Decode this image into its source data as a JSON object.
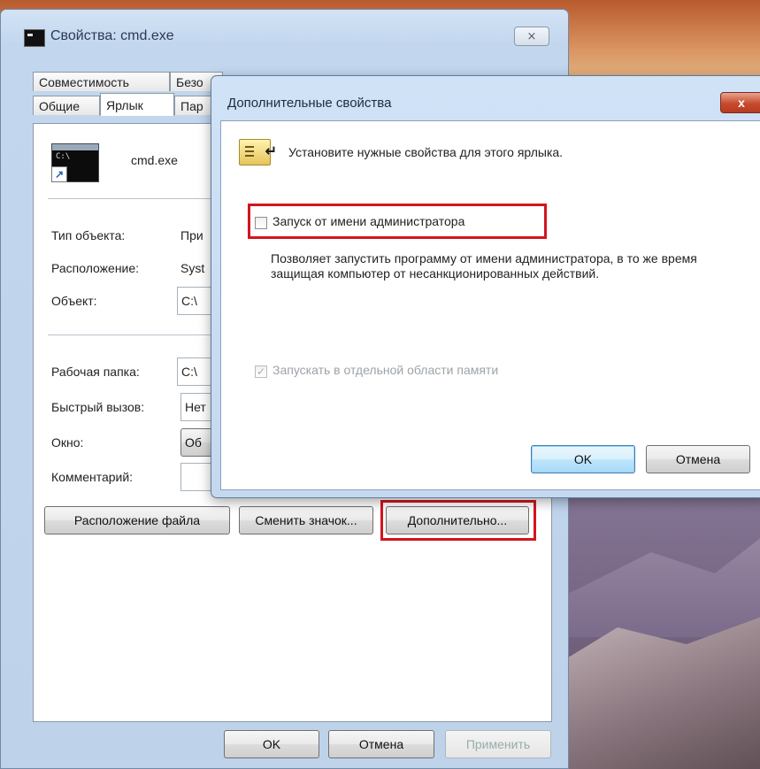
{
  "props_window": {
    "title": "Свойства: cmd.exe",
    "close_glyph": "⨯",
    "tabs_row1": [
      "Совместимость",
      "Безо"
    ],
    "tabs_row2": [
      "Общие",
      "Ярлык",
      "Пар"
    ],
    "file_name": "cmd.exe",
    "icon_text": "C:\\",
    "fields": {
      "type_label": "Тип объекта:",
      "type_value": "При",
      "location_label": "Расположение:",
      "location_value": "Syst",
      "target_label": "Объект:",
      "target_value": "C:\\",
      "start_in_label": "Рабочая папка:",
      "start_in_value": "C:\\",
      "shortcut_key_label": "Быстрый вызов:",
      "shortcut_key_value": "Нет",
      "run_label": "Окно:",
      "run_value": "Об",
      "comment_label": "Комментарий:",
      "comment_value": ""
    },
    "buttons": {
      "open_location": "Расположение файла",
      "change_icon": "Сменить значок...",
      "advanced": "Дополнительно...",
      "ok": "OK",
      "cancel": "Отмена",
      "apply": "Применить"
    }
  },
  "advanced_dialog": {
    "title": "Дополнительные свойства",
    "close_glyph": "x",
    "header_text": "Установите нужные свойства для этого ярлыка.",
    "run_as_admin": {
      "label": "Запуск от имени администратора",
      "checked": false
    },
    "run_as_admin_desc": "Позволяет запустить программу от имени администратора, в то же время защищая компьютер от несанкционированных действий.",
    "separate_memory": {
      "label": "Запускать в отдельной области памяти",
      "checked": true,
      "disabled": true,
      "check_glyph": "✓"
    },
    "ok": "OK",
    "cancel": "Отмена"
  },
  "colors": {
    "highlight": "#d3151f",
    "window_frame": "#c2d6ee",
    "close_red": "#c74a2c"
  }
}
